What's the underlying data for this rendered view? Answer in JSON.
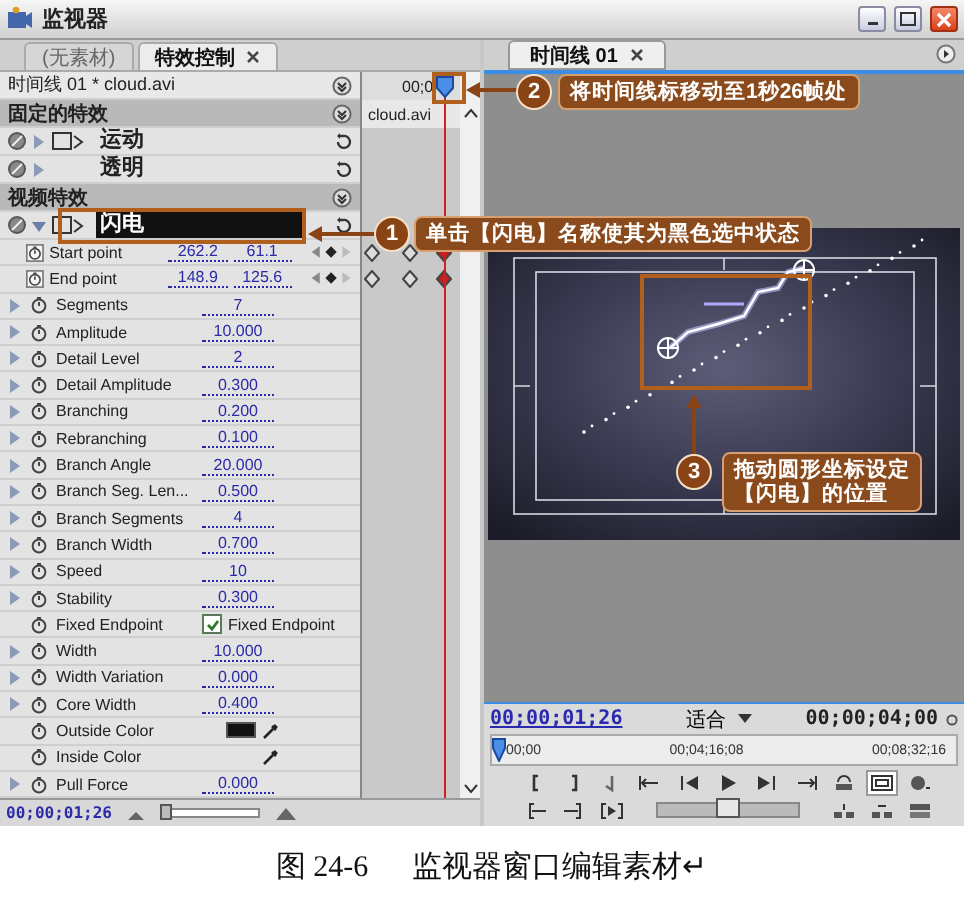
{
  "window": {
    "title": "监视器"
  },
  "effect_controls": {
    "tabs": [
      {
        "label": "(无素材)",
        "selected": false,
        "closable": false
      },
      {
        "label": "特效控制",
        "selected": true,
        "closable": true
      }
    ],
    "sequence_label": "时间线 01 * cloud.avi",
    "timeline_time": "00;0",
    "clip_name": "cloud.avi",
    "sections": [
      {
        "kind": "header",
        "label": "固定的特效"
      },
      {
        "kind": "effect",
        "label": "运动",
        "selected": false,
        "expanded": false,
        "has_icon": true
      },
      {
        "kind": "effect",
        "label": "透明",
        "selected": false,
        "expanded": false,
        "has_icon": false
      },
      {
        "kind": "header",
        "label": "视频特效"
      },
      {
        "kind": "effect",
        "label": "闪电",
        "selected": true,
        "expanded": true,
        "has_icon": true
      }
    ],
    "params": [
      {
        "kind": "point",
        "name": "Start point",
        "values": [
          "262.2",
          "61.1"
        ]
      },
      {
        "kind": "point",
        "name": "End point",
        "values": [
          "148.9",
          "125.6"
        ]
      },
      {
        "kind": "number",
        "name": "Segments",
        "value": "7"
      },
      {
        "kind": "number",
        "name": "Amplitude",
        "value": "10.000"
      },
      {
        "kind": "number",
        "name": "Detail Level",
        "value": "2"
      },
      {
        "kind": "number",
        "name": "Detail Amplitude",
        "value": "0.300"
      },
      {
        "kind": "number",
        "name": "Branching",
        "value": "0.200"
      },
      {
        "kind": "number",
        "name": "Rebranching",
        "value": "0.100"
      },
      {
        "kind": "number",
        "name": "Branch Angle",
        "value": "20.000"
      },
      {
        "kind": "number",
        "name": "Branch Seg. Len...",
        "value": "0.500"
      },
      {
        "kind": "number",
        "name": "Branch Segments",
        "value": "4"
      },
      {
        "kind": "number",
        "name": "Branch Width",
        "value": "0.700"
      },
      {
        "kind": "number",
        "name": "Speed",
        "value": "10"
      },
      {
        "kind": "number",
        "name": "Stability",
        "value": "0.300"
      },
      {
        "kind": "checkbox",
        "name": "Fixed Endpoint",
        "label": "Fixed Endpoint",
        "checked": true
      },
      {
        "kind": "number",
        "name": "Width",
        "value": "10.000"
      },
      {
        "kind": "number",
        "name": "Width Variation",
        "value": "0.000"
      },
      {
        "kind": "number",
        "name": "Core Width",
        "value": "0.400"
      },
      {
        "kind": "color",
        "name": "Outside Color",
        "color": "#111111"
      },
      {
        "kind": "color",
        "name": "Inside Color"
      },
      {
        "kind": "number",
        "name": "Pull Force",
        "value": "0.000"
      }
    ],
    "zoom_slider": {
      "level": 0.05
    },
    "timecode": "00;00;01;26"
  },
  "program_monitor": {
    "tabs": [
      {
        "label": "时间线 01",
        "selected": true
      }
    ],
    "timecode": "00;00;01;26",
    "zoom": "适合",
    "duration": "00;00;04;00",
    "ruler_labels": [
      "00;00",
      "00;04;16;08",
      "00;08;32;16"
    ],
    "shuttle": {
      "level": 0.5
    }
  },
  "annotations": [
    {
      "number": "2",
      "lines": [
        "将时间线标移动至1秒26帧处"
      ]
    },
    {
      "number": "1",
      "lines": [
        "单击【闪电】名称使其为黑色选中状态"
      ]
    },
    {
      "number": "3",
      "lines": [
        "拖动圆形坐标设定",
        "【闪电】的位置"
      ]
    }
  ],
  "caption": {
    "figure": "图 24-6",
    "text": "监视器窗口编辑素材↵"
  }
}
